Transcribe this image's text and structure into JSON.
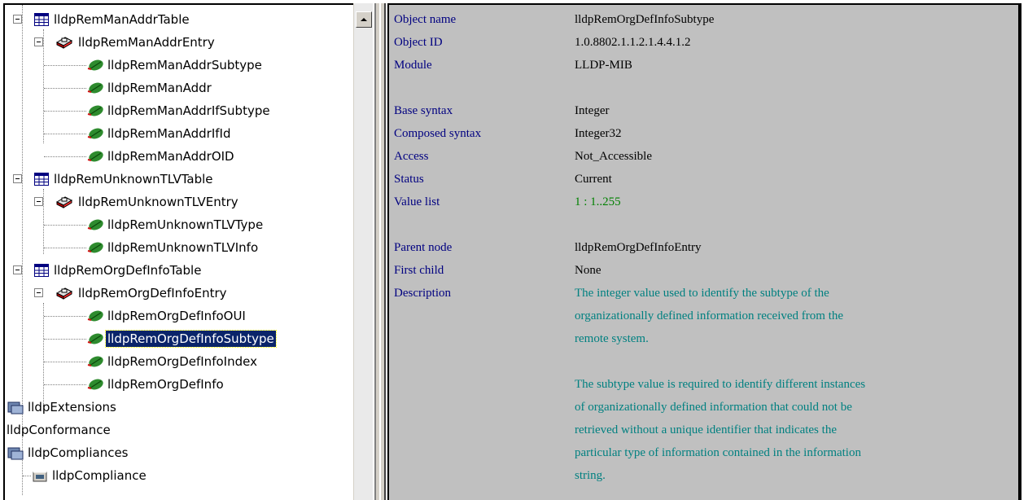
{
  "tree": {
    "nodes": [
      {
        "label": "lldpRemManAddrTable",
        "icon": "table-icon",
        "expanded": true
      },
      {
        "label": "lldpRemManAddrEntry",
        "icon": "entry-icon",
        "expanded": true
      },
      {
        "label": "lldpRemManAddrSubtype",
        "icon": "leaf-icon"
      },
      {
        "label": "lldpRemManAddr",
        "icon": "leaf-icon"
      },
      {
        "label": "lldpRemManAddrIfSubtype",
        "icon": "leaf-icon"
      },
      {
        "label": "lldpRemManAddrIfId",
        "icon": "leaf-icon"
      },
      {
        "label": "lldpRemManAddrOID",
        "icon": "leaf-icon"
      },
      {
        "label": "lldpRemUnknownTLVTable",
        "icon": "table-icon",
        "expanded": true
      },
      {
        "label": "lldpRemUnknownTLVEntry",
        "icon": "entry-icon",
        "expanded": true
      },
      {
        "label": "lldpRemUnknownTLVType",
        "icon": "leaf-icon"
      },
      {
        "label": "lldpRemUnknownTLVInfo",
        "icon": "leaf-icon"
      },
      {
        "label": "lldpRemOrgDefInfoTable",
        "icon": "table-icon",
        "expanded": true
      },
      {
        "label": "lldpRemOrgDefInfoEntry",
        "icon": "entry-icon",
        "expanded": true
      },
      {
        "label": "lldpRemOrgDefInfoOUI",
        "icon": "leaf-icon"
      },
      {
        "label": "lldpRemOrgDefInfoSubtype",
        "icon": "leaf-icon",
        "selected": true
      },
      {
        "label": "lldpRemOrgDefInfoIndex",
        "icon": "leaf-icon"
      },
      {
        "label": "lldpRemOrgDefInfo",
        "icon": "leaf-icon"
      },
      {
        "label": "lldpExtensions",
        "icon": "group-icon"
      },
      {
        "label": "lldpConformance",
        "icon": "none"
      },
      {
        "label": "lldpCompliances",
        "icon": "group-icon"
      },
      {
        "label": "lldpCompliance",
        "icon": "compliance-icon"
      }
    ]
  },
  "info": {
    "object_name": {
      "label": "Object name",
      "value": "lldpRemOrgDefInfoSubtype"
    },
    "object_id": {
      "label": "Object ID",
      "value": "1.0.8802.1.1.2.1.4.4.1.2"
    },
    "module": {
      "label": "Module",
      "value": "LLDP-MIB"
    },
    "base_syntax": {
      "label": "Base syntax",
      "value": "Integer"
    },
    "composed_syntax": {
      "label": "Composed syntax",
      "value": "Integer32"
    },
    "access": {
      "label": "Access",
      "value": "Not_Accessible"
    },
    "status": {
      "label": "Status",
      "value": "Current"
    },
    "value_list": {
      "label": "Value list",
      "value": "1 : 1..255"
    },
    "parent_node": {
      "label": "Parent node",
      "value": "lldpRemOrgDefInfoEntry"
    },
    "first_child": {
      "label": "First child",
      "value": "None"
    },
    "description": {
      "label": "Description",
      "lines": [
        "The integer value used to identify the subtype of the",
        "organizationally defined information received from the",
        "remote system.",
        "",
        "The subtype value is required to identify different instances",
        "of organizationally defined information that could not be",
        "retrieved without a unique identifier that indicates the",
        "particular type of information contained in the information",
        "string."
      ]
    }
  },
  "colors": {
    "selection": "#0a246a",
    "info_background": "#c0c0c0",
    "label_color": "#000080",
    "value_list_color": "#008000",
    "description_color": "#008080",
    "leaf_green": "#2e8b2e",
    "leaf_red": "#d01010"
  }
}
